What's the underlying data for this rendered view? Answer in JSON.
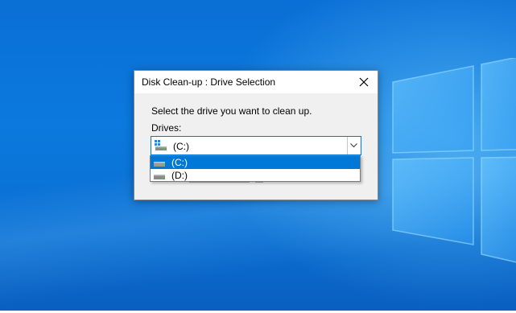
{
  "dialog": {
    "title": "Disk Clean-up : Drive Selection",
    "instruction": "Select the drive you want to clean up.",
    "drives_label": "Drives:",
    "selected_drive": "(C:)"
  },
  "dropdown": {
    "options": [
      {
        "label": "(C:)",
        "selected": true
      },
      {
        "label": "(D:)",
        "selected": false
      }
    ]
  },
  "icons": {
    "close": "close-icon",
    "dropdown_arrow": "chevron-down-icon",
    "system_drive": "system-drive-icon",
    "drive": "hard-drive-icon",
    "windows_logo": "windows-logo"
  },
  "colors": {
    "accent": "#0078d7",
    "desktop": "#0b79de",
    "dialog_bg": "#f0f0f0"
  }
}
